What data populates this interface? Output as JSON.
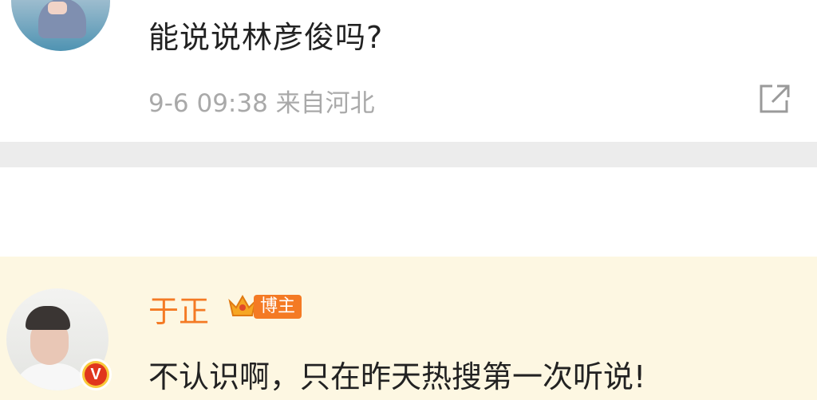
{
  "post": {
    "text": "能说说林彦俊吗?",
    "meta": "9-6 09:38 来自河北"
  },
  "reply": {
    "username": "于正",
    "owner_badge": "博主",
    "text": "不认识啊，只在昨天热搜第一次听说!"
  },
  "icons": {
    "share": "share-external-icon",
    "verified": "verified-v-icon",
    "crown": "crown-icon"
  },
  "colors": {
    "username": "#f47a24",
    "reply_background": "#fdf7e2",
    "divider": "#ececec",
    "meta_text": "#a9a9a9"
  }
}
